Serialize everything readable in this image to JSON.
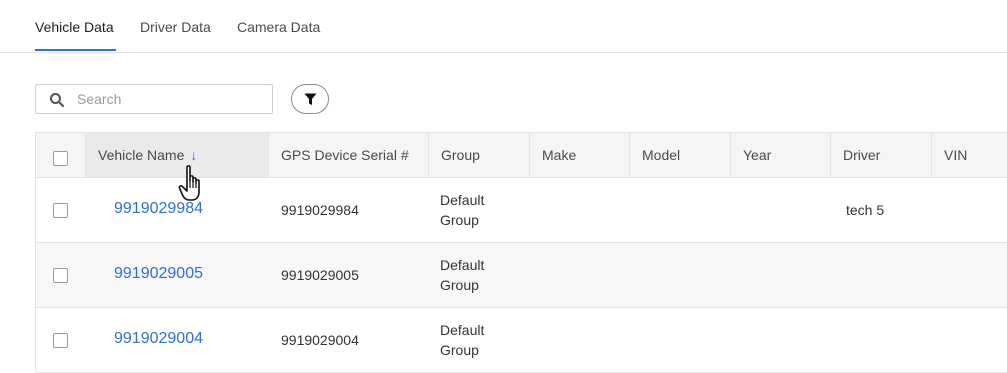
{
  "tabs": [
    {
      "label": "Vehicle Data",
      "active": true
    },
    {
      "label": "Driver Data",
      "active": false
    },
    {
      "label": "Camera Data",
      "active": false
    }
  ],
  "search": {
    "placeholder": "Search",
    "value": ""
  },
  "filter": {
    "icon": "filter-icon"
  },
  "table": {
    "columns": [
      "Vehicle Name",
      "GPS Device Serial #",
      "Group",
      "Make",
      "Model",
      "Year",
      "Driver",
      "VIN"
    ],
    "sorted_column": "Vehicle Name",
    "sort_direction": "descending",
    "rows": [
      {
        "vehicle_name": "9919029984",
        "gps_serial": "9919029984",
        "group_line1": "Default",
        "group_line2": "Group",
        "make": "",
        "model": "",
        "year": "",
        "driver": "tech 5",
        "vin": ""
      },
      {
        "vehicle_name": "9919029005",
        "gps_serial": "9919029005",
        "group_line1": "Default",
        "group_line2": "Group",
        "make": "",
        "model": "",
        "year": "",
        "driver": "",
        "vin": ""
      },
      {
        "vehicle_name": "9919029004",
        "gps_serial": "9919029004",
        "group_line1": "Default",
        "group_line2": "Group",
        "make": "",
        "model": "",
        "year": "",
        "driver": "",
        "vin": ""
      }
    ]
  },
  "colors": {
    "accent": "#2f6fd6",
    "header_bg": "#f5f5f5",
    "border": "#e3e3e3"
  }
}
